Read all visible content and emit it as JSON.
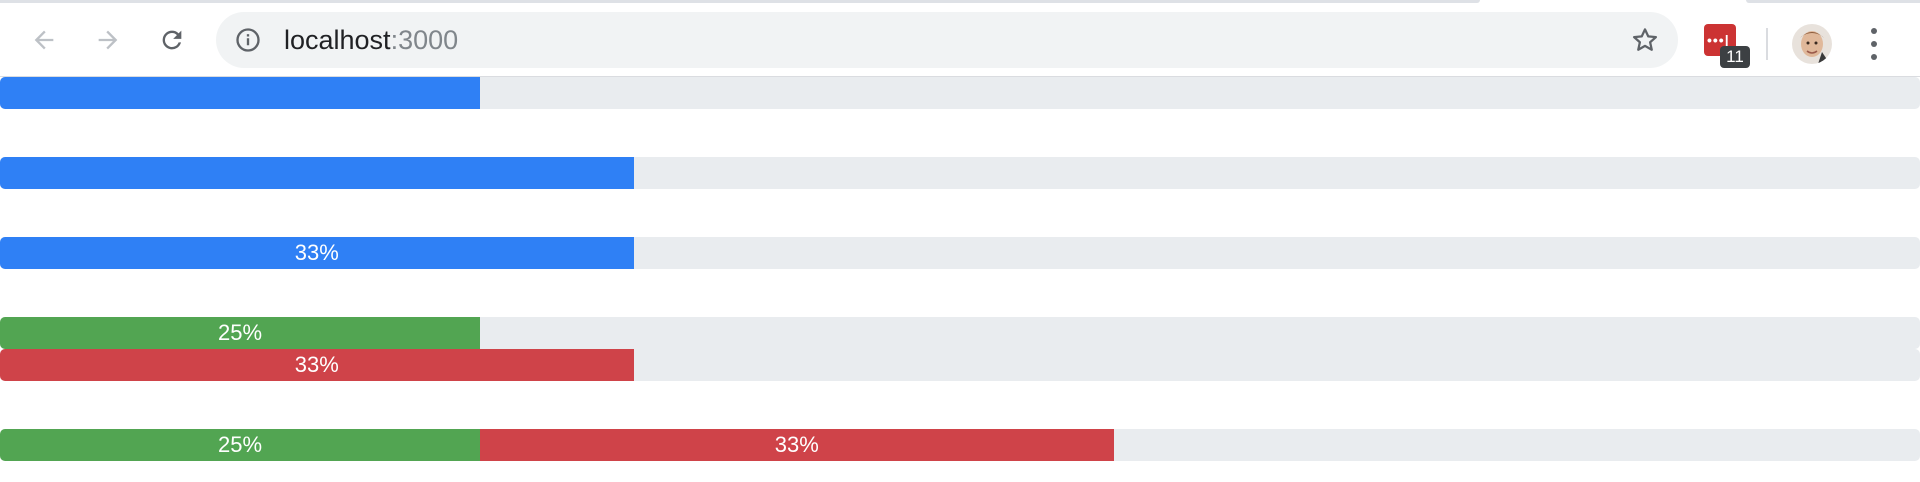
{
  "browser": {
    "url_host": "localhost",
    "url_port": ":3000",
    "extension_badge": "11",
    "icons": [
      "back-arrow-icon",
      "forward-arrow-icon",
      "reload-icon",
      "info-icon",
      "star-icon",
      "extension-icon",
      "avatar",
      "more-vert-icon"
    ]
  },
  "progress_bars": [
    {
      "segments": [
        {
          "value": 25,
          "label": "",
          "color": "#2f80f5"
        }
      ]
    },
    {
      "segments": [
        {
          "value": 33,
          "label": "",
          "color": "#2f80f5"
        }
      ]
    },
    {
      "segments": [
        {
          "value": 33,
          "label": "33%",
          "color": "#2f80f5"
        }
      ]
    },
    {
      "segments": [
        {
          "value": 25,
          "label": "25%",
          "color": "#52a552"
        }
      ]
    },
    {
      "segments": [
        {
          "value": 33,
          "label": "33%",
          "color": "#cf4349"
        }
      ]
    },
    {
      "segments": [
        {
          "value": 25,
          "label": "25%",
          "color": "#52a552"
        },
        {
          "value": 33,
          "label": "33%",
          "color": "#cf4349"
        }
      ]
    }
  ]
}
